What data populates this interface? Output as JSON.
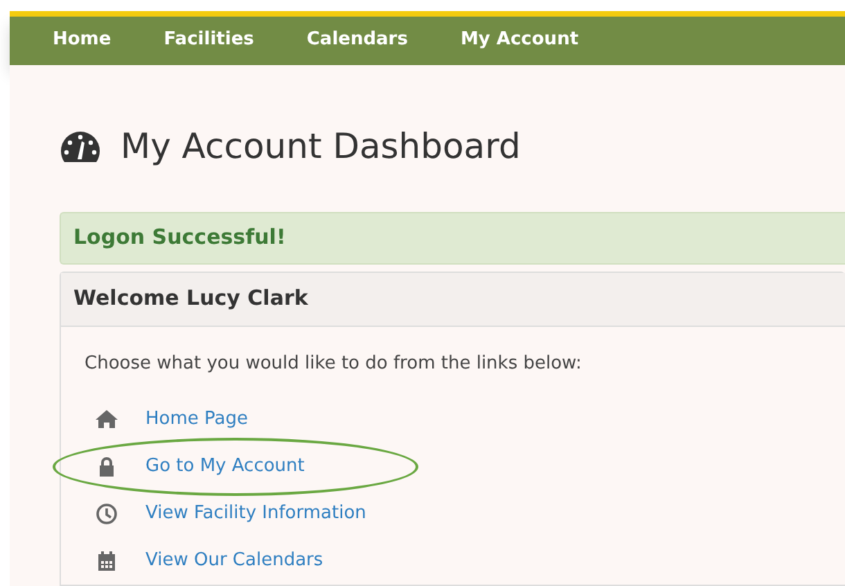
{
  "nav": [
    {
      "label": "Home"
    },
    {
      "label": "Facilities"
    },
    {
      "label": "Calendars"
    },
    {
      "label": "My Account"
    }
  ],
  "heading": "My Account Dashboard",
  "alert": "Logon Successful!",
  "panel": {
    "title": "Welcome Lucy Clark",
    "intro": "Choose what you would like to do from the links below:",
    "links": [
      {
        "kind": "home",
        "label": "Home Page",
        "circled": false
      },
      {
        "kind": "lock",
        "label": "Go to My Account",
        "circled": true
      },
      {
        "kind": "clock",
        "label": "View Facility Information",
        "circled": false
      },
      {
        "kind": "calendar",
        "label": "View Our Calendars",
        "circled": false
      }
    ]
  }
}
